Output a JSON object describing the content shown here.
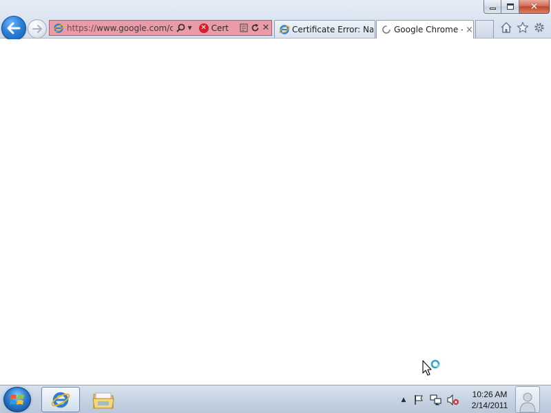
{
  "window": {
    "caption_buttons": {
      "minimize": "minimize-icon",
      "maximize": "restore-icon",
      "close": "close-icon"
    }
  },
  "navigation": {
    "back_icon": "back-arrow-icon",
    "forward_icon": "forward-arrow-icon"
  },
  "address_bar": {
    "url_prefix": "https://",
    "url_rest": "www.google.com/chr",
    "certificate_label": "Cert",
    "background_color": "#eb9ba8",
    "icons": [
      "ie-page-icon",
      "search-icon",
      "dropdown-icon",
      "certificate-error-icon",
      "compatibility-view-icon",
      "refresh-icon",
      "stop-icon"
    ]
  },
  "tabs": [
    {
      "title": "Certificate Error: Nav...",
      "icon": "ie-page-icon",
      "active": false
    },
    {
      "title": "Google Chrome -...",
      "icon": "loading-icon",
      "active": true,
      "close": "×"
    }
  ],
  "command_bar": {
    "icons": [
      "home-icon",
      "favorites-star-icon",
      "tools-gear-icon"
    ]
  },
  "taskbar": {
    "start_icon": "windows-logo-icon",
    "pinned": [
      "internet-explorer-icon",
      "windows-explorer-icon"
    ],
    "tray_icons": [
      "show-hidden-icons",
      "action-center-flag-icon",
      "network-icon",
      "volume-muted-icon"
    ],
    "clock": {
      "time": "10:26 AM",
      "date": "2/14/2011"
    }
  },
  "cursor": "busy-pointer-icon"
}
